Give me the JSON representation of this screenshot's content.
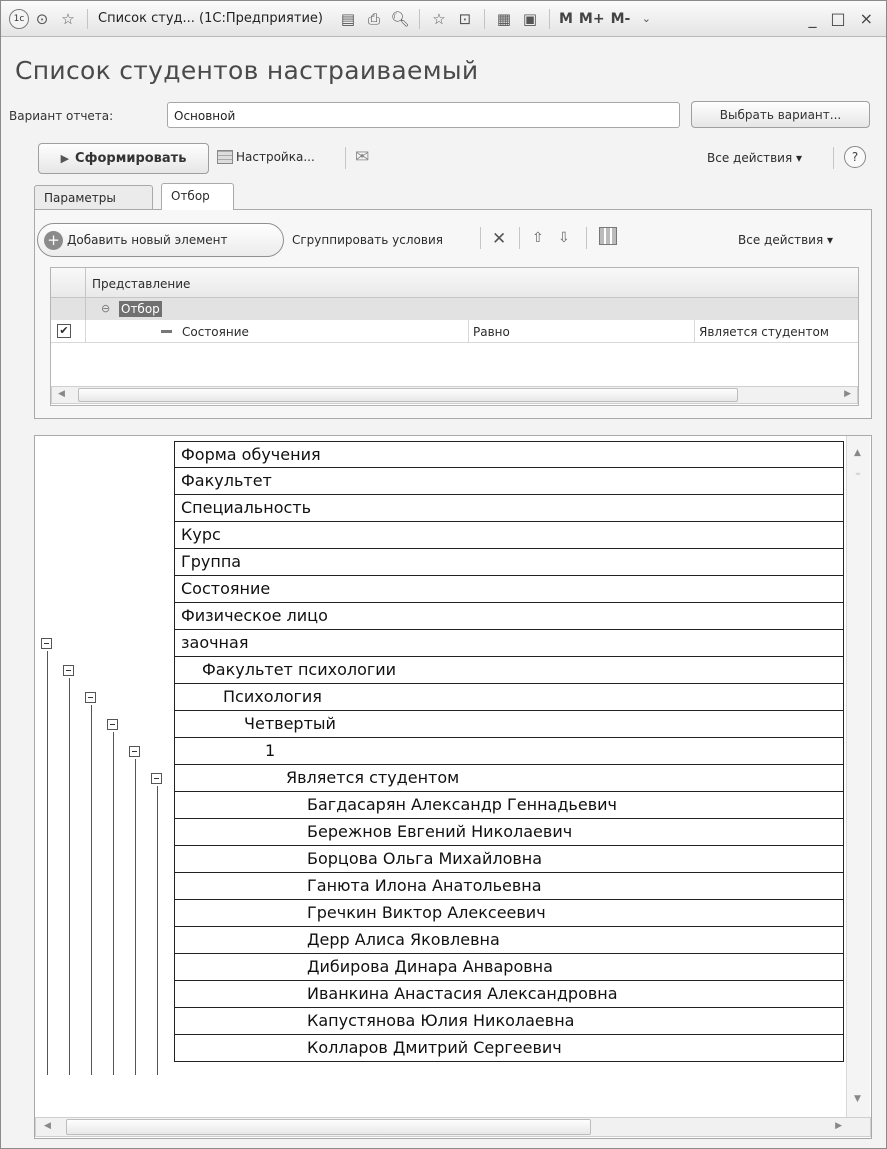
{
  "titlebar": {
    "app_icon": "1c-logo-icon",
    "title": "Список студ... (1С:Предприятие)",
    "m": "M",
    "m_plus": "M+",
    "m_minus": "M-",
    "minimize": "_",
    "maximize": "□",
    "close": "×"
  },
  "report": {
    "title": "Список студентов настраиваемый",
    "variant_label": "Вариант отчета:",
    "variant_value": "Основной",
    "choose_variant": "Выбрать вариант...",
    "generate": "Сформировать",
    "settings": "Настройка...",
    "all_actions": "Все действия ▾",
    "help": "?"
  },
  "tabs": [
    {
      "label": "Параметры",
      "active": false
    },
    {
      "label": "Отбор",
      "active": true
    }
  ],
  "filter": {
    "add_element": "Добавить новый элемент",
    "group_conditions": "Сгруппировать условия",
    "all_actions": "Все действия ▾",
    "column_header": "Представление",
    "group_label": "Отбор",
    "rows": [
      {
        "checked": true,
        "field": "Состояние",
        "comparison": "Равно",
        "value": "Является студентом"
      }
    ]
  },
  "report_rows": [
    {
      "text": "Форма обучения",
      "indent": 0
    },
    {
      "text": "Факультет",
      "indent": 0
    },
    {
      "text": "Специальность",
      "indent": 0
    },
    {
      "text": "Курс",
      "indent": 0
    },
    {
      "text": "Группа",
      "indent": 0
    },
    {
      "text": "Состояние",
      "indent": 0
    },
    {
      "text": "Физическое лицо",
      "indent": 0
    },
    {
      "text": "заочная",
      "indent": 0
    },
    {
      "text": "Факультет психологии",
      "indent": 1
    },
    {
      "text": "Психология",
      "indent": 2
    },
    {
      "text": "Четвертый",
      "indent": 3
    },
    {
      "text": "1",
      "indent": 4
    },
    {
      "text": "Является студентом",
      "indent": 5
    },
    {
      "text": "Багдасарян Александр Геннадьевич",
      "indent": 6
    },
    {
      "text": "Бережнов Евгений  Николаевич",
      "indent": 6
    },
    {
      "text": "Борцова Ольга Михайловна",
      "indent": 6
    },
    {
      "text": "Ганюта Илона Анатольевна",
      "indent": 6
    },
    {
      "text": "Гречкин Виктор Алексеевич",
      "indent": 6
    },
    {
      "text": "Дерр Алиса Яковлевна",
      "indent": 6
    },
    {
      "text": "Дибирова Динара Анваровна",
      "indent": 6
    },
    {
      "text": "Иванкина Анастасия Александровна",
      "indent": 6
    },
    {
      "text": "Капустянова Юлия Николаевна",
      "indent": 6
    },
    {
      "text": "Колларов Дмитрий Сергеевич",
      "indent": 6
    }
  ]
}
